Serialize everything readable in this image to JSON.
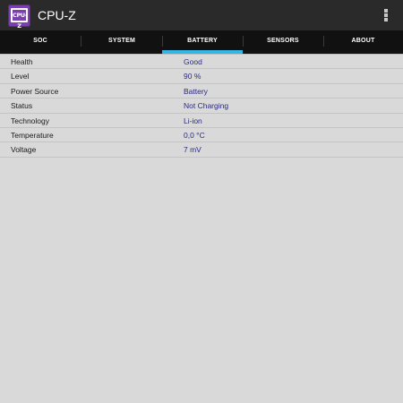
{
  "app": {
    "title": "CPU-Z",
    "icon_text": "CPU-Z",
    "icon": "cpu-chip-icon",
    "accent": "#33b5e5"
  },
  "tabs": [
    {
      "label": "SOC"
    },
    {
      "label": "SYSTEM"
    },
    {
      "label": "BATTERY",
      "selected": true
    },
    {
      "label": "SENSORS"
    },
    {
      "label": "ABOUT"
    }
  ],
  "battery": [
    {
      "key": "Health",
      "value": "Good"
    },
    {
      "key": "Level",
      "value": "90 %"
    },
    {
      "key": "Power Source",
      "value": "Battery"
    },
    {
      "key": "Status",
      "value": "Not Charging"
    },
    {
      "key": "Technology",
      "value": "Li-ion"
    },
    {
      "key": "Temperature",
      "value": "0,0 °C"
    },
    {
      "key": "Voltage",
      "value": "7 mV"
    }
  ]
}
